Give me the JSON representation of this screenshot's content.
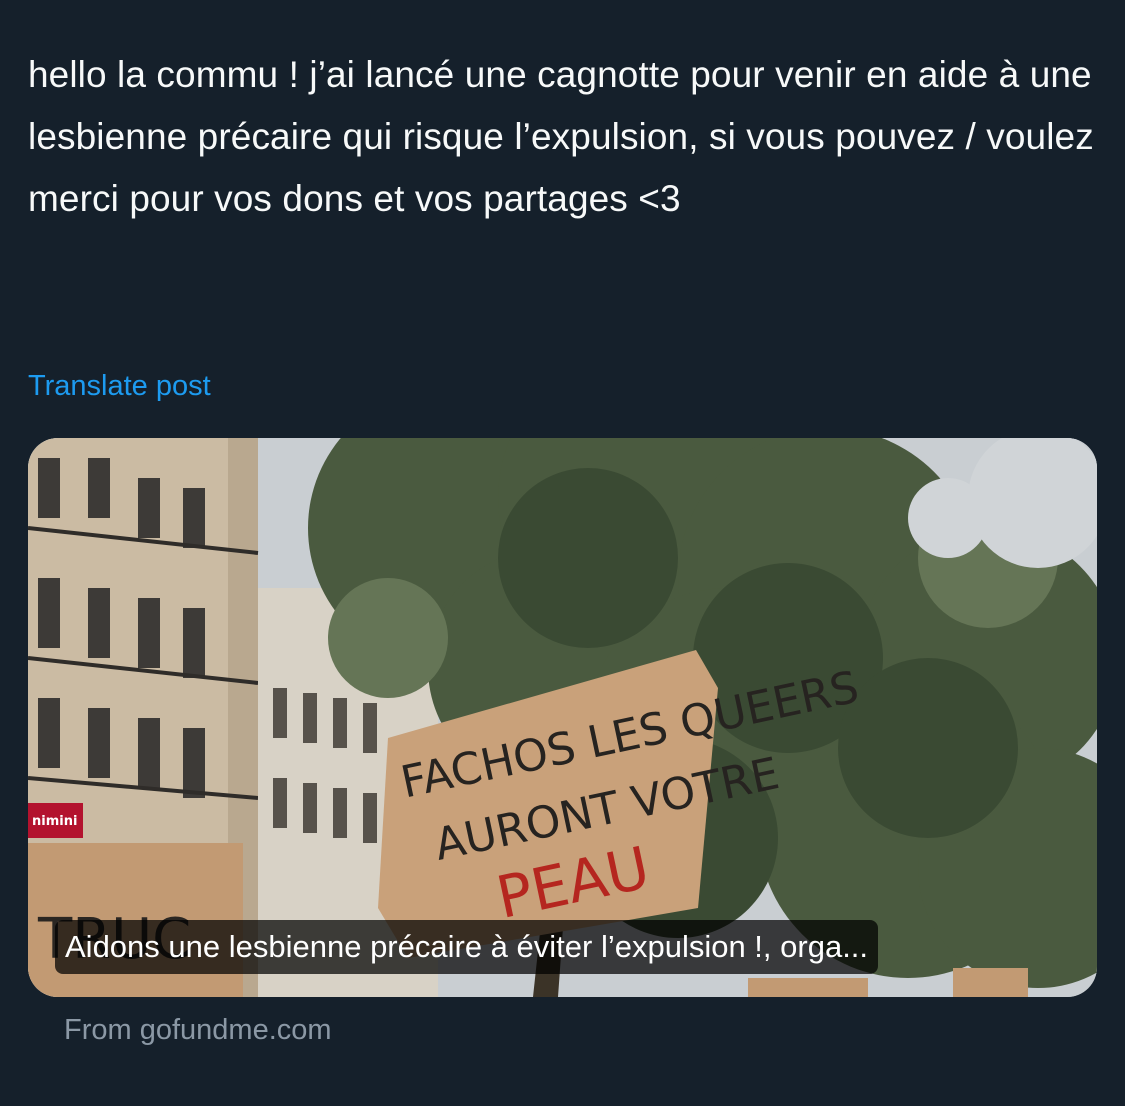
{
  "post": {
    "text": "hello la commu ! j’ai lancé une cagnotte pour venir en aide à une lesbienne précaire qui risque l’expulsion, si vous pouvez / voulez merci pour vos dons et vos partages <3",
    "translate_label": "Translate post"
  },
  "link_card": {
    "title": "Aidons une lesbienne précaire à éviter l’expulsion !, orga...",
    "source": "From gofundme.com",
    "image": {
      "sign_line1": "FACHOS LES QUEERS",
      "sign_line2": "AURONT VOTRE",
      "sign_line3": "PEAU",
      "shop_sign": "nimini"
    }
  },
  "colors": {
    "background": "#15202b",
    "text": "#f7f9f9",
    "link": "#1d9bf0",
    "muted": "#8b98a5"
  }
}
